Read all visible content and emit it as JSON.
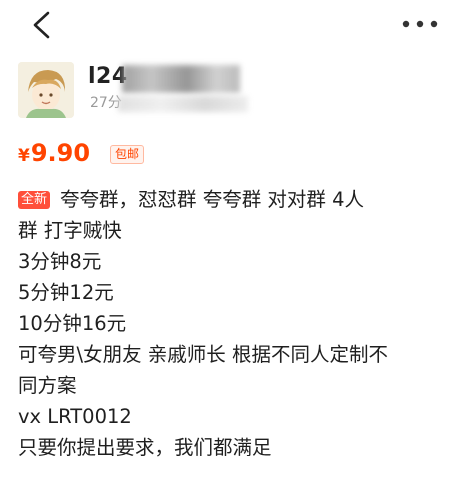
{
  "nav": {
    "back_icon": "chevron-left-icon",
    "more_icon": "more-dots-icon"
  },
  "seller": {
    "name": "l24",
    "time": "27分"
  },
  "price": {
    "currency": "¥",
    "amount": "9.90",
    "shipping_tag": "包邮",
    "color": "#ff4400"
  },
  "listing": {
    "new_tag": "全新",
    "lines": [
      "夸夸群，怼怼群 夸夸群 对对群 4人",
      "群 打字贼快",
      "3分钟8元",
      "5分钟12元",
      "10分钟16元",
      "可夸男\\女朋友 亲戚师长 根据不同人定制不",
      "同方案",
      "vx LRT0012",
      "只要你提出要求，我们都满足"
    ]
  }
}
